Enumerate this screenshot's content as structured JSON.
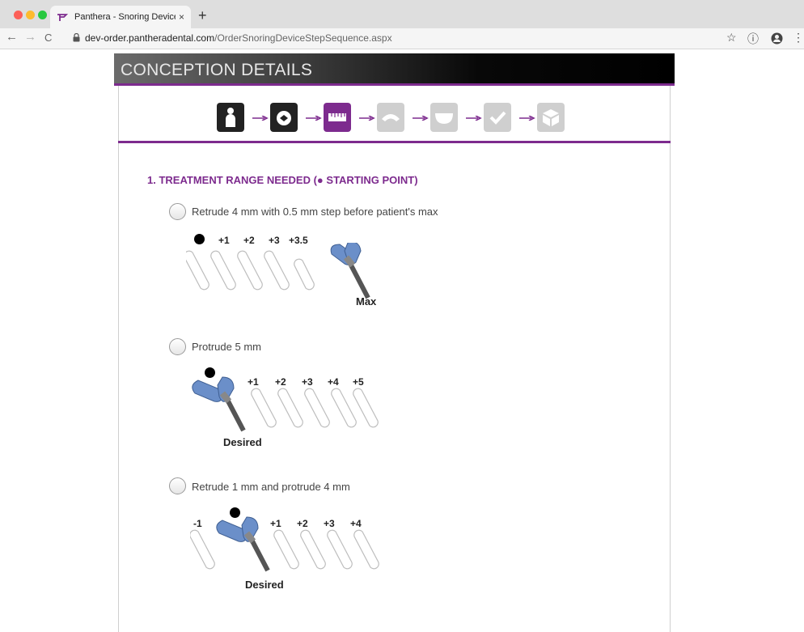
{
  "browser": {
    "tab_title": "Panthera - Snoring Device Order",
    "tab_close": "×",
    "new_tab": "+",
    "url_host": "dev-order.pantheradental.com",
    "url_path": "/OrderSnoringDeviceStepSequence.aspx",
    "nav_back": "←",
    "nav_forward": "→",
    "nav_reload": "C",
    "star": "☆",
    "info": "ⓘ",
    "menu": "⋮"
  },
  "page": {
    "header_title": "CONCEPTION DETAILS",
    "section_title": "1. TREATMENT RANGE NEEDED (● STARTING POINT)",
    "options": [
      {
        "label": "Retrude 4 mm with 0.5 mm step before patient's max",
        "steps": [
          "+1",
          "+2",
          "+3",
          "+3.5"
        ],
        "caption": "Max"
      },
      {
        "label": "Protrude 5 mm",
        "steps": [
          "+1",
          "+2",
          "+3",
          "+4",
          "+5"
        ],
        "caption": "Desired"
      },
      {
        "label": "Retrude 1 mm and protrude 4 mm",
        "pre_step": "-1",
        "steps": [
          "+1",
          "+2",
          "+3",
          "+4"
        ],
        "caption": "Desired"
      }
    ]
  },
  "steps": [
    {
      "icon": "patient-icon",
      "state": "done"
    },
    {
      "icon": "tooth-scan-icon",
      "state": "done"
    },
    {
      "icon": "ruler-icon",
      "state": "active"
    },
    {
      "icon": "device-icon",
      "state": "pending"
    },
    {
      "icon": "tray-icon",
      "state": "pending"
    },
    {
      "icon": "check-icon",
      "state": "pending"
    },
    {
      "icon": "box-icon",
      "state": "pending"
    }
  ],
  "colors": {
    "accent": "#7d2b8e",
    "step_done": "#222222",
    "step_pending": "#cfcfcf",
    "device_blue": "#6b8fc9"
  }
}
